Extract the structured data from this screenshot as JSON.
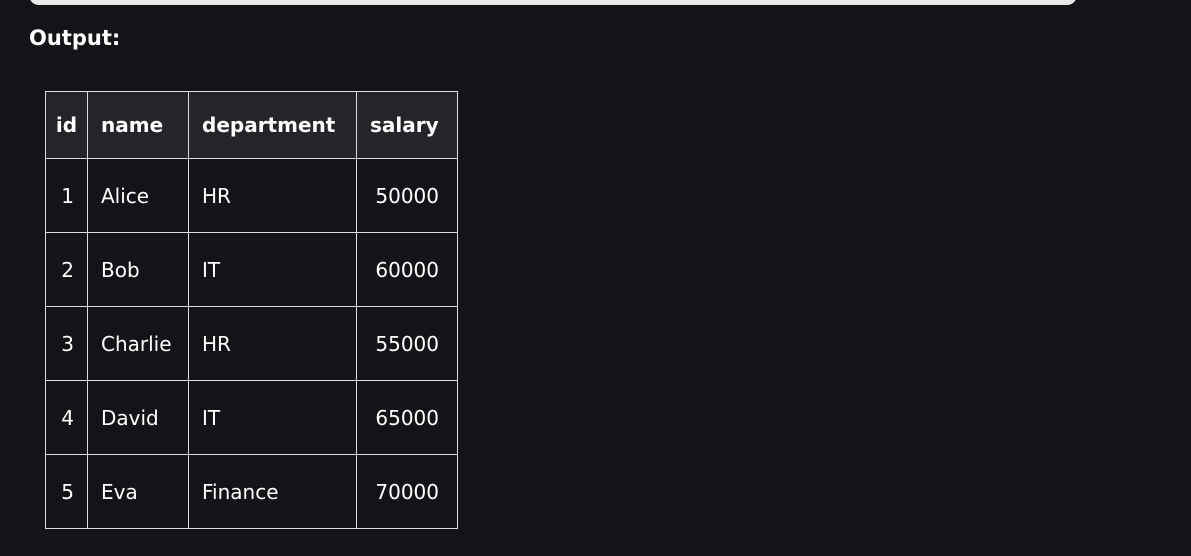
{
  "output_label": "Output:",
  "table": {
    "columns": [
      "id",
      "name",
      "department",
      "salary"
    ],
    "rows": [
      [
        "1",
        "Alice",
        "HR",
        "50000"
      ],
      [
        "2",
        "Bob",
        "IT",
        "60000"
      ],
      [
        "3",
        "Charlie",
        "HR",
        "55000"
      ],
      [
        "4",
        "David",
        "IT",
        "65000"
      ],
      [
        "5",
        "Eva",
        "Finance",
        "70000"
      ]
    ]
  }
}
